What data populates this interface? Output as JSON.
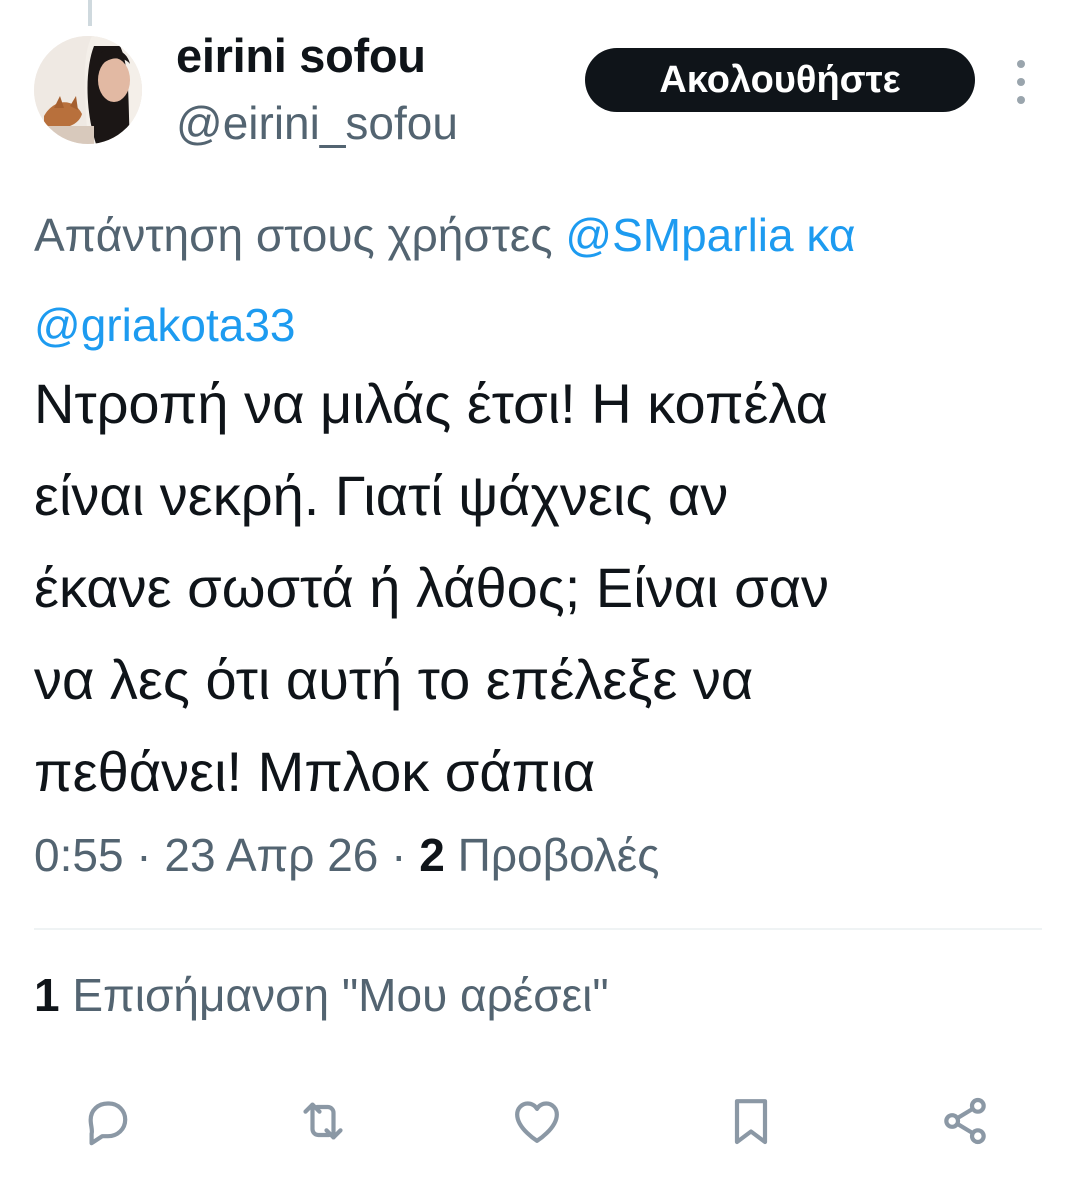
{
  "author": {
    "name": "eirini sofou",
    "handle": "@eirini_sofou"
  },
  "follow_button": {
    "label": "Ακολουθήστε"
  },
  "reply_to": {
    "prefix": "Απάντηση στους χρήστες",
    "mention_1": "@SMparlia",
    "connector": "κα",
    "mention_2": "@griakota33"
  },
  "tweet": {
    "text": "Ντροπή να μιλάς έτσι! Η κοπέλα\nείναι νεκρή. Γιατί ψάχνεις αν\nέκανε σωστά ή λάθος; Είναι σαν\nνα λες ότι αυτή το επέλεξε να\nπεθάνει! Μπλοκ σάπια"
  },
  "meta": {
    "time": "0:55",
    "separator_1": " · ",
    "date": "23 Απρ 26",
    "separator_2": " · ",
    "views_count": "2",
    "views_label": "Προβολές"
  },
  "likes": {
    "count": "1",
    "label": "Επισήμανση \"Μου αρέσει\""
  },
  "actions": {
    "icons": [
      "reply-icon",
      "retweet-icon",
      "like-icon",
      "bookmark-icon",
      "share-icon"
    ]
  },
  "colors": {
    "text": "#0f1419",
    "secondary": "#536471",
    "link": "#1d9bf0",
    "button_bg": "#0f1419",
    "icon": "#8b98a5"
  }
}
